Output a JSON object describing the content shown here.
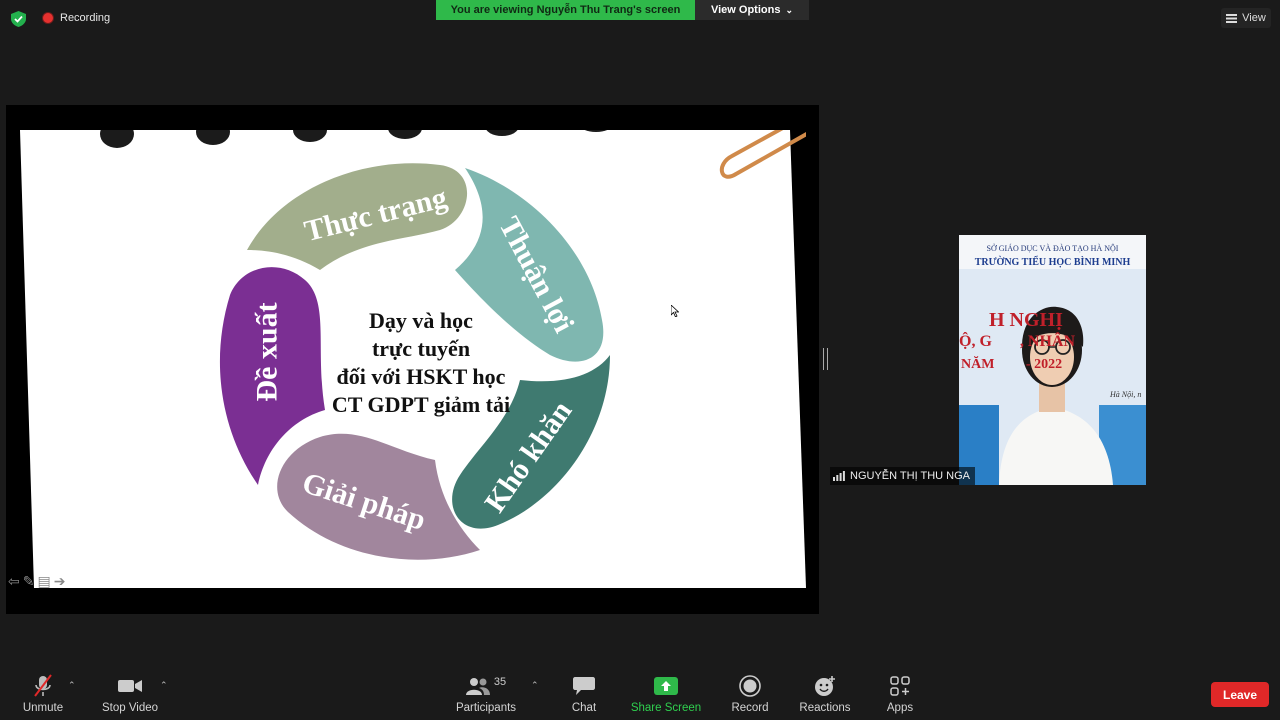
{
  "top_bar": {
    "recording_label": "Recording",
    "viewing_banner": "You are viewing Nguyễn Thu Trang's screen",
    "view_options_label": "View Options",
    "view_label": "View"
  },
  "slide": {
    "center_lines": [
      "Dạy và học",
      "trực tuyến",
      "đối với HSKT học",
      "CT GDPT giảm tải"
    ],
    "petals": [
      {
        "label": "Thực trạng",
        "color": "#a2ae8c"
      },
      {
        "label": "Thuận lợi",
        "color": "#7fb7b0"
      },
      {
        "label": "Khó khăn",
        "color": "#3f7a70"
      },
      {
        "label": "Giải pháp",
        "color": "#a1869d"
      },
      {
        "label": "Đề xuất",
        "color": "#7b2f93"
      }
    ]
  },
  "participant_video": {
    "school_line1": "SỞ GIÁO DỤC VÀ ĐÀO TẠO HÀ NỘI",
    "school_line2": "TRƯỜNG TIỂU HỌC BÌNH MINH",
    "banner_line1": "H   NGHỊ",
    "banner_line2": "Ộ, G       , NHÂN",
    "banner_line3": "NĂM         - 2022",
    "banner_line4": "Hà Nội, n",
    "name": "NGUYỄN THỊ THU NGA"
  },
  "toolbar": {
    "unmute_label": "Unmute",
    "stop_video_label": "Stop Video",
    "participants_label": "Participants",
    "participants_count": "35",
    "chat_label": "Chat",
    "share_screen_label": "Share Screen",
    "record_label": "Record",
    "reactions_label": "Reactions",
    "apps_label": "Apps",
    "leave_label": "Leave"
  },
  "colors": {
    "share_green": "#2fb94a",
    "leave_red": "#e02828",
    "recording_red": "#e5312f"
  }
}
